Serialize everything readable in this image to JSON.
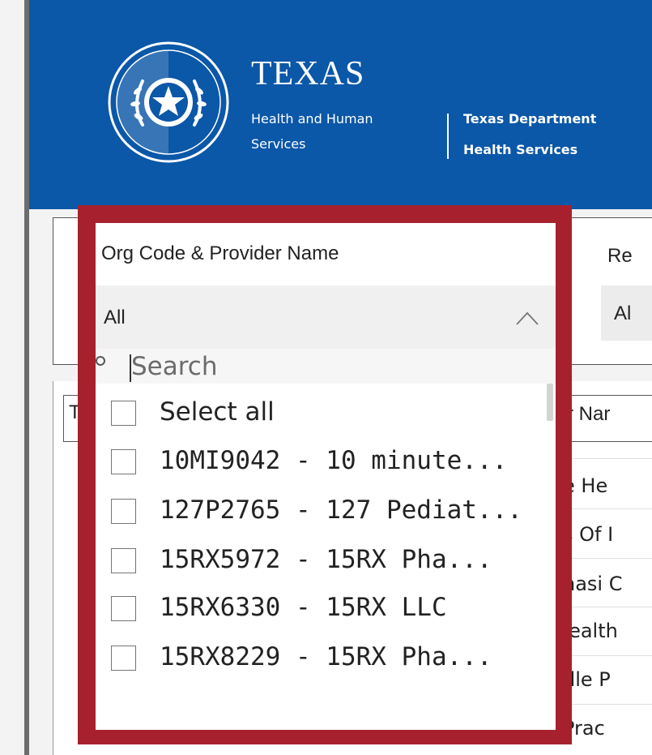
{
  "header": {
    "logo_word": "TEXAS",
    "hhs_line1": "Health and Human",
    "hhs_line2": "Services",
    "dshs_line1": "Texas Department",
    "dshs_line2": "Health Services",
    "banner_color": "#0b57a8"
  },
  "slicers": {
    "region_label": "Re",
    "region_value": "Al"
  },
  "table": {
    "header_first": "T",
    "header_provider": "r Nar",
    "rows": [
      "e He",
      "s Of I",
      "nasi C",
      "Iealth",
      "dle P",
      "Prac"
    ]
  },
  "dropdown": {
    "title": "Org Code & Provider Name",
    "selected_value": "All",
    "search_placeholder": "Search",
    "highlight_color": "#a6212d",
    "items": [
      "Select all",
      "10MI9042 - 10 minute...",
      "127P2765 - 127 Pediat...",
      "15RX5972 - 15RX Pha...",
      "15RX6330 - 15RX LLC",
      "15RX8229 - 15RX Pha..."
    ]
  }
}
